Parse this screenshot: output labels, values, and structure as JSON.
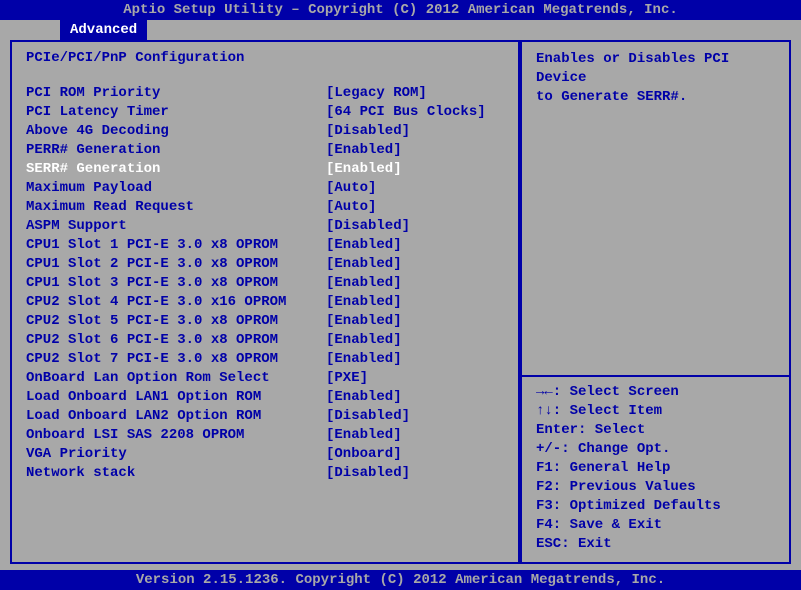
{
  "header": {
    "title": "Aptio Setup Utility – Copyright (C) 2012 American Megatrends, Inc."
  },
  "tab": {
    "label": "Advanced"
  },
  "section_title": "PCIe/PCI/PnP Configuration",
  "options": [
    {
      "label": "PCI ROM Priority",
      "value": "[Legacy ROM]",
      "selected": false
    },
    {
      "label": "PCI Latency Timer",
      "value": "[64 PCI Bus Clocks]",
      "selected": false
    },
    {
      "label": "Above 4G Decoding",
      "value": "[Disabled]",
      "selected": false
    },
    {
      "label": "PERR# Generation",
      "value": "[Enabled]",
      "selected": false
    },
    {
      "label": "SERR# Generation",
      "value": "[Enabled]",
      "selected": true
    },
    {
      "label": "Maximum Payload",
      "value": "[Auto]",
      "selected": false
    },
    {
      "label": "Maximum Read Request",
      "value": "[Auto]",
      "selected": false
    },
    {
      "label": "ASPM Support",
      "value": "[Disabled]",
      "selected": false
    },
    {
      "label": "CPU1 Slot 1 PCI-E 3.0 x8 OPROM",
      "value": "[Enabled]",
      "selected": false
    },
    {
      "label": "CPU1 Slot 2 PCI-E 3.0 x8 OPROM",
      "value": "[Enabled]",
      "selected": false
    },
    {
      "label": "CPU1 Slot 3 PCI-E 3.0 x8 OPROM",
      "value": "[Enabled]",
      "selected": false
    },
    {
      "label": "CPU2 Slot 4 PCI-E 3.0 x16 OPROM",
      "value": "[Enabled]",
      "selected": false
    },
    {
      "label": "CPU2 Slot 5 PCI-E 3.0 x8 OPROM",
      "value": "[Enabled]",
      "selected": false
    },
    {
      "label": "CPU2 Slot 6 PCI-E 3.0 x8 OPROM",
      "value": "[Enabled]",
      "selected": false
    },
    {
      "label": "CPU2 Slot 7 PCI-E 3.0 x8 OPROM",
      "value": "[Enabled]",
      "selected": false
    },
    {
      "label": "OnBoard Lan Option Rom Select",
      "value": "[PXE]",
      "selected": false
    },
    {
      "label": "Load Onboard LAN1 Option ROM",
      "value": "[Enabled]",
      "selected": false
    },
    {
      "label": "Load Onboard LAN2 Option ROM",
      "value": "[Disabled]",
      "selected": false
    },
    {
      "label": "Onboard LSI SAS 2208 OPROM",
      "value": "[Enabled]",
      "selected": false
    },
    {
      "label": "VGA Priority",
      "value": "[Onboard]",
      "selected": false
    },
    {
      "label": "Network stack",
      "value": "[Disabled]",
      "selected": false
    }
  ],
  "help": {
    "line1": "Enables or Disables PCI Device",
    "line2": "to Generate SERR#."
  },
  "keys": [
    "→←: Select Screen",
    "↑↓: Select Item",
    "Enter: Select",
    "+/-: Change Opt.",
    "F1: General Help",
    "F2: Previous Values",
    "F3: Optimized Defaults",
    "F4: Save & Exit",
    "ESC: Exit"
  ],
  "footer": {
    "text": "Version 2.15.1236. Copyright (C) 2012 American Megatrends, Inc."
  }
}
